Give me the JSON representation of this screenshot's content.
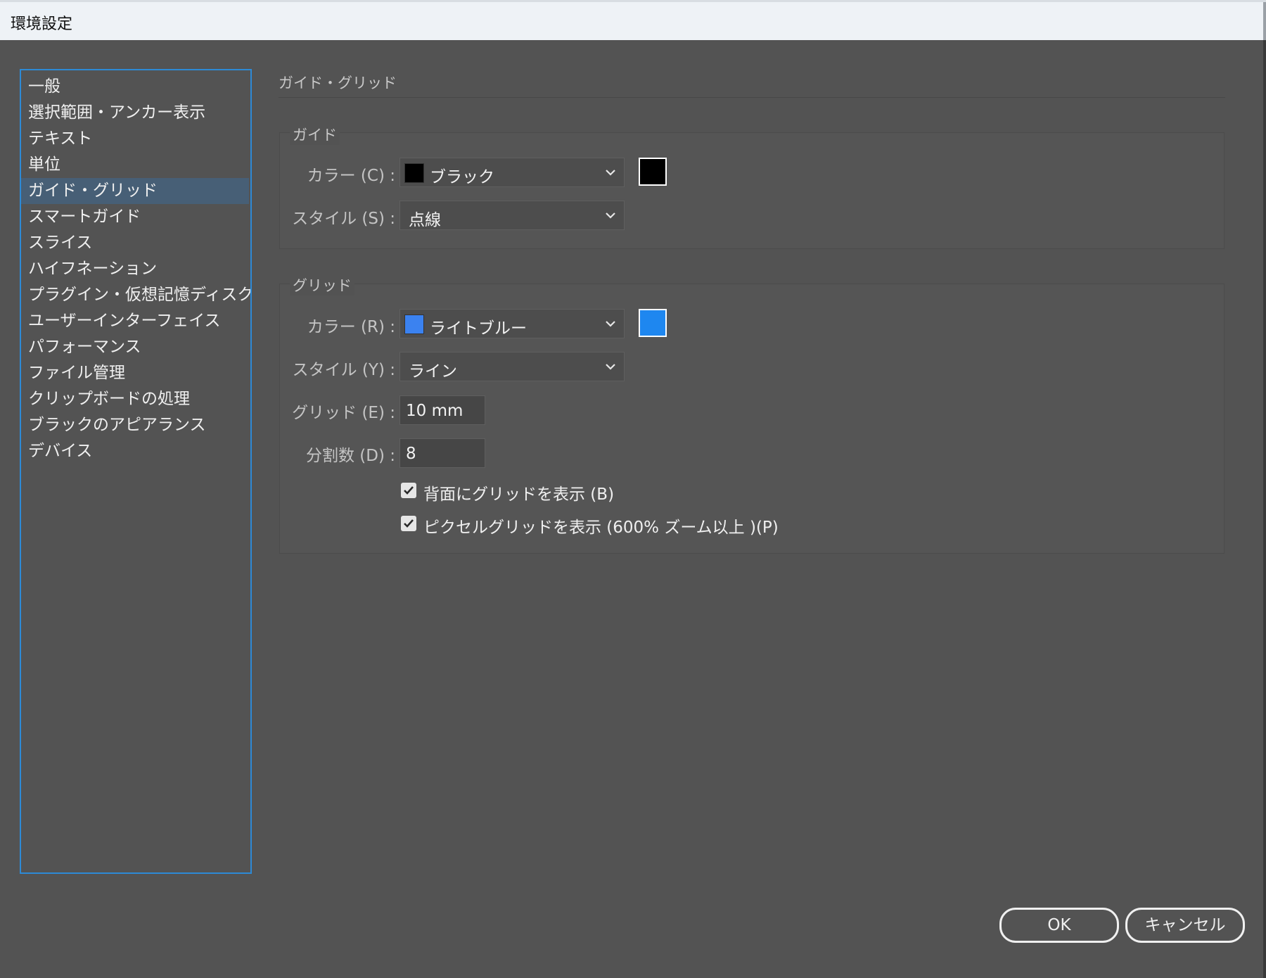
{
  "window": {
    "title": "環境設定"
  },
  "sidebar": {
    "selected_index": 4,
    "items": [
      {
        "label": "一般"
      },
      {
        "label": "選択範囲・アンカー表示"
      },
      {
        "label": "テキスト"
      },
      {
        "label": "単位"
      },
      {
        "label": "ガイド・グリッド"
      },
      {
        "label": "スマートガイド"
      },
      {
        "label": "スライス"
      },
      {
        "label": "ハイフネーション"
      },
      {
        "label": "プラグイン・仮想記憶ディスク"
      },
      {
        "label": "ユーザーインターフェイス"
      },
      {
        "label": "パフォーマンス"
      },
      {
        "label": "ファイル管理"
      },
      {
        "label": "クリップボードの処理"
      },
      {
        "label": "ブラックのアピアランス"
      },
      {
        "label": "デバイス"
      }
    ]
  },
  "panel": {
    "title": "ガイド・グリッド",
    "guides": {
      "group_label": "ガイド",
      "color_label": "カラー (C) :",
      "color_value": "ブラック",
      "color_hex": "#000000",
      "style_label": "スタイル (S) :",
      "style_value": "点線"
    },
    "grid": {
      "group_label": "グリッド",
      "color_label": "カラー (R) :",
      "color_value": "ライトブルー",
      "color_hex": "#1e87f0",
      "swatch_small_hex": "#3b82f0",
      "style_label": "スタイル (Y) :",
      "style_value": "ライン",
      "gridline_label": "グリッド (E) :",
      "gridline_value": "10 mm",
      "subdiv_label": "分割数 (D) :",
      "subdiv_value": "8",
      "grids_in_back_label": "背面にグリッドを表示 (B)",
      "grids_in_back_checked": true,
      "pixel_grid_label": "ピクセルグリッドを表示 (600% ズーム以上 )(P)",
      "pixel_grid_checked": true
    }
  },
  "buttons": {
    "ok": "OK",
    "cancel": "キャンセル"
  },
  "colors": {
    "accent_border": "#2d8ad6",
    "selected_item": "#475f76",
    "background": "#535353"
  }
}
